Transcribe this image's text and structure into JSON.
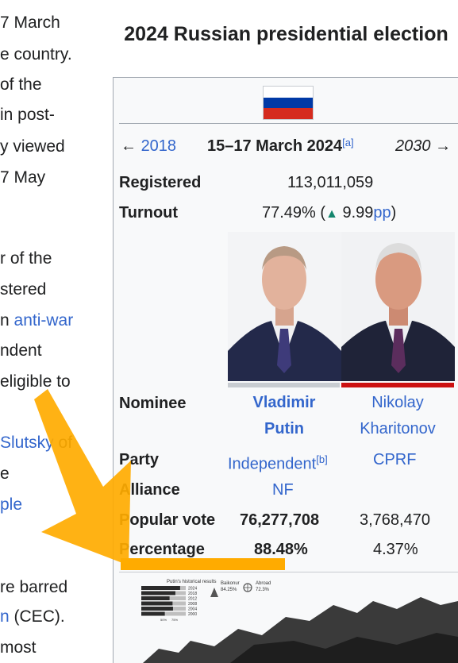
{
  "article": {
    "lines": [
      {
        "pre": "7 March",
        "link": "",
        "post": ""
      },
      {
        "pre": "e country.",
        "link": "",
        "post": ""
      },
      {
        "pre": " of the",
        "link": "",
        "post": ""
      },
      {
        "pre": "in post-",
        "link": "",
        "post": ""
      },
      {
        "pre": "y viewed",
        "link": "",
        "post": ""
      },
      {
        "pre": "7 May",
        "link": "",
        "post": ""
      },
      {
        "pre": "r of the",
        "link": "",
        "post": ""
      },
      {
        "pre": "stered",
        "link": "",
        "post": ""
      },
      {
        "pre": "n ",
        "link": "anti-war",
        "post": ""
      },
      {
        "pre": "ndent",
        "link": "",
        "post": ""
      },
      {
        "pre": "eligible to",
        "link": "",
        "post": ""
      },
      {
        "pre": "",
        "link": "Slutsky",
        "post": " of"
      },
      {
        "pre": "e",
        "link": "",
        "post": ""
      },
      {
        "pre": "",
        "link": "ple",
        "post": ""
      },
      {
        "pre": "re barred",
        "link": "",
        "post": ""
      },
      {
        "pre": "",
        "link": "n",
        "post": " (CEC)."
      },
      {
        "pre": "most",
        "link": "",
        "post": ""
      }
    ]
  },
  "infobox": {
    "title": "2024 Russian presidential election",
    "flag_colors": [
      "#ffffff",
      "#0039a6",
      "#d52b1e"
    ],
    "nav": {
      "prev_arrow": "←",
      "prev_year": "2018",
      "date": "15–17 March 2024",
      "date_note": "[a]",
      "next_year": "2030",
      "next_arrow": "→"
    },
    "registered": {
      "label": "Registered",
      "value": "113,011,059"
    },
    "turnout": {
      "label": "Turnout",
      "value": "77.49% (",
      "arrow": "▲",
      "change": " 9.99",
      "unit": "pp",
      "close": ")"
    },
    "candidates": [
      {
        "first": "Vladimir",
        "last": "Putin",
        "party": "Independent",
        "party_note": "[b]",
        "alliance": "NF",
        "popular_vote": "76,277,708",
        "percentage": "88.48%",
        "color": "#c8ccd1"
      },
      {
        "first": "Nikolay",
        "last": "Kharitonov",
        "party": "CPRF",
        "party_note": "",
        "alliance": "",
        "popular_vote": "3,768,470",
        "percentage": "4.37%",
        "color": "#cc1111"
      }
    ],
    "labels": {
      "nominee": "Nominee",
      "party": "Party",
      "alliance": "Alliance",
      "popular_vote": "Popular vote",
      "percentage": "Percentage"
    },
    "map": {
      "history_title": "Putin's historical results",
      "years": [
        "2024",
        "2018",
        "2012",
        "2008",
        "2004",
        "2000"
      ],
      "history_values": [
        87.3,
        76.7,
        63.6,
        70.3,
        71.3,
        52.9
      ],
      "axis_ticks": [
        "50%",
        "75%"
      ],
      "baikonur_label": "Baikonur",
      "baikonur_value": "84.25%",
      "abroad_label": "Abroad",
      "abroad_value": "72.3%"
    }
  },
  "annotation": {
    "color": "#ffab00"
  }
}
